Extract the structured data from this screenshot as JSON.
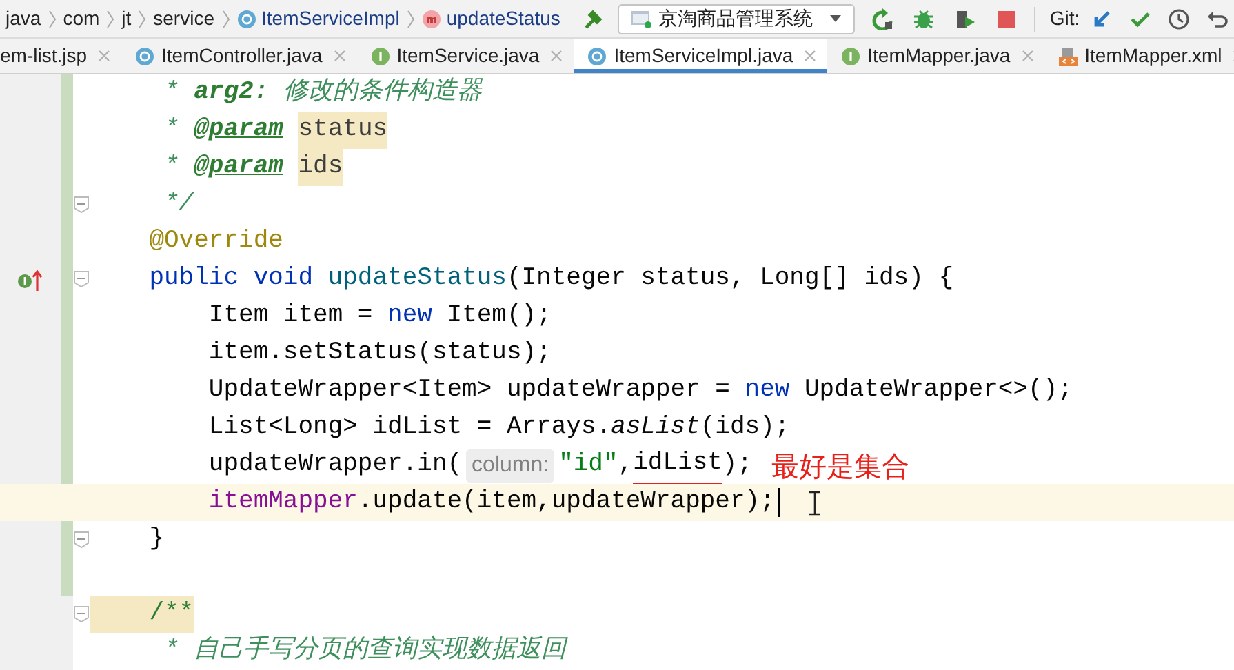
{
  "breadcrumb": [
    {
      "label": "java",
      "kind": "folder"
    },
    {
      "label": "com",
      "kind": "folder"
    },
    {
      "label": "jt",
      "kind": "folder"
    },
    {
      "label": "service",
      "kind": "folder"
    },
    {
      "label": "ItemServiceImpl",
      "kind": "class"
    },
    {
      "label": "updateStatus",
      "kind": "method"
    }
  ],
  "run_config": {
    "label": "京淘商品管理系统"
  },
  "toolbar": {
    "git_label": "Git:"
  },
  "tabs": [
    {
      "label": "em-list.jsp",
      "kind": "none",
      "selected": false
    },
    {
      "label": "ItemController.java",
      "kind": "class",
      "selected": false
    },
    {
      "label": "ItemService.java",
      "kind": "interface",
      "selected": false
    },
    {
      "label": "ItemServiceImpl.java",
      "kind": "class",
      "selected": true
    },
    {
      "label": "ItemMapper.java",
      "kind": "interface",
      "selected": false
    },
    {
      "label": "ItemMapper.xml",
      "kind": "xml",
      "selected": false
    }
  ],
  "editor": {
    "lines": [
      {
        "tokens": [
          {
            "text": "     * ",
            "kind": "doc"
          },
          {
            "text": "arg2:",
            "kind": "doc-tag"
          },
          {
            "text": " 修改的条件构造器",
            "kind": "doc"
          }
        ]
      },
      {
        "tokens": [
          {
            "text": "     * ",
            "kind": "doc"
          },
          {
            "text": "@param",
            "kind": "doc-param-tag"
          },
          {
            "text": "status",
            "kind": "doc-param"
          }
        ]
      },
      {
        "tokens": [
          {
            "text": "     * ",
            "kind": "doc"
          },
          {
            "text": "@param",
            "kind": "doc-param-tag"
          },
          {
            "text": "ids",
            "kind": "doc-param"
          }
        ]
      },
      {
        "tokens": [
          {
            "text": "     */",
            "kind": "doc"
          }
        ],
        "fold": true
      },
      {
        "tokens": [
          {
            "text": "    @Override",
            "kind": "annotation"
          }
        ]
      },
      {
        "tokens": [
          {
            "text": "    public void ",
            "kind": "keyword"
          },
          {
            "text": "updateStatus",
            "kind": "decl"
          },
          {
            "text": "(Integer status, Long[] ids) {",
            "kind": "plain"
          }
        ],
        "fold": true,
        "implements_marker": true
      },
      {
        "tokens": [
          {
            "text": "        Item item = ",
            "kind": "plain"
          },
          {
            "text": "new ",
            "kind": "keyword"
          },
          {
            "text": "Item();",
            "kind": "plain"
          }
        ]
      },
      {
        "tokens": [
          {
            "text": "        item.setStatus(status);",
            "kind": "plain"
          }
        ]
      },
      {
        "tokens": [
          {
            "text": "        UpdateWrapper<Item> updateWrapper = ",
            "kind": "plain"
          },
          {
            "text": "new ",
            "kind": "keyword"
          },
          {
            "text": "UpdateWrapper<>();",
            "kind": "plain"
          }
        ]
      },
      {
        "tokens": [
          {
            "text": "        List<Long> idList = Arrays.",
            "kind": "plain"
          },
          {
            "text": "asList",
            "kind": "static"
          },
          {
            "text": "(ids);",
            "kind": "plain"
          }
        ]
      },
      {
        "tokens": [
          {
            "text": "        updateWrapper.in(",
            "kind": "plain"
          },
          {
            "text": "column:",
            "kind": "hint"
          },
          {
            "text": "\"id\"",
            "kind": "string"
          },
          {
            "text": ",",
            "kind": "plain"
          },
          {
            "text": "idList",
            "kind": "marked"
          },
          {
            "text": ");",
            "kind": "plain"
          }
        ],
        "note": "最好是集合"
      },
      {
        "tokens": [
          {
            "text": "        itemMapper",
            "kind": "field"
          },
          {
            "text": ".update(item,updateWrapper);",
            "kind": "plain"
          }
        ],
        "current": true
      },
      {
        "tokens": [
          {
            "text": "    }",
            "kind": "plain"
          }
        ],
        "fold": true
      },
      {
        "tokens": [
          {
            "text": "    /**",
            "kind": "doc-open"
          }
        ],
        "fold": true,
        "blank_line_before": true
      },
      {
        "tokens": [
          {
            "text": "     * 自己手写分页的查询实现数据返回",
            "kind": "doc"
          }
        ]
      }
    ]
  }
}
